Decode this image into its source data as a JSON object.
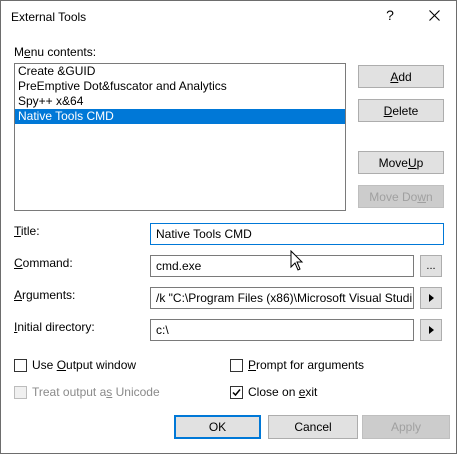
{
  "window": {
    "title": "External Tools",
    "help_glyph": "?"
  },
  "menu_contents": {
    "label_pre": "M",
    "label_ul": "e",
    "label_post": "nu contents:",
    "items": [
      {
        "label": "Create &GUID"
      },
      {
        "label": "PreEmptive Dot&fuscator and Analytics"
      },
      {
        "label": "Spy++ x&64"
      },
      {
        "label": "Native Tools CMD",
        "selected": true
      }
    ]
  },
  "buttons": {
    "add": {
      "ul": "A",
      "rest": "dd"
    },
    "delete": {
      "ul": "D",
      "rest": "elete"
    },
    "move_up": {
      "pre": "Move ",
      "ul": "U",
      "post": "p"
    },
    "move_down": {
      "pre": "Move Do",
      "ul": "w",
      "post": "n",
      "disabled": true
    },
    "ok": "OK",
    "cancel": "Cancel",
    "apply": "Apply"
  },
  "fields": {
    "title": {
      "label_ul": "T",
      "label_rest": "itle:",
      "value": "Native Tools CMD"
    },
    "command": {
      "label_ul": "C",
      "label_rest": "ommand:",
      "value": "cmd.exe",
      "browse": "..."
    },
    "arguments": {
      "label_ul": "A",
      "label_rest": "rguments:",
      "value": "/k \"C:\\Program Files (x86)\\Microsoft Visual Studi"
    },
    "initial_directory": {
      "label_ul": "I",
      "label_rest": "nitial directory:",
      "value": "c:\\"
    }
  },
  "checkboxes": {
    "use_output_window": {
      "pre": "Use ",
      "ul": "O",
      "post": "utput window",
      "checked": false
    },
    "prompt_for_arguments": {
      "pre": "",
      "ul": "P",
      "post": "rompt for arguments",
      "checked": false
    },
    "treat_output_as_unicode": {
      "pre": "Treat output a",
      "ul": "s",
      "post": " Unicode",
      "checked": false,
      "disabled": true
    },
    "close_on_exit": {
      "pre": "Close on ",
      "ul": "e",
      "post": "xit",
      "checked": true
    }
  },
  "colors": {
    "accent": "#0078d7",
    "button_face": "#e1e1e1",
    "disabled_text": "#a0a0a0"
  }
}
